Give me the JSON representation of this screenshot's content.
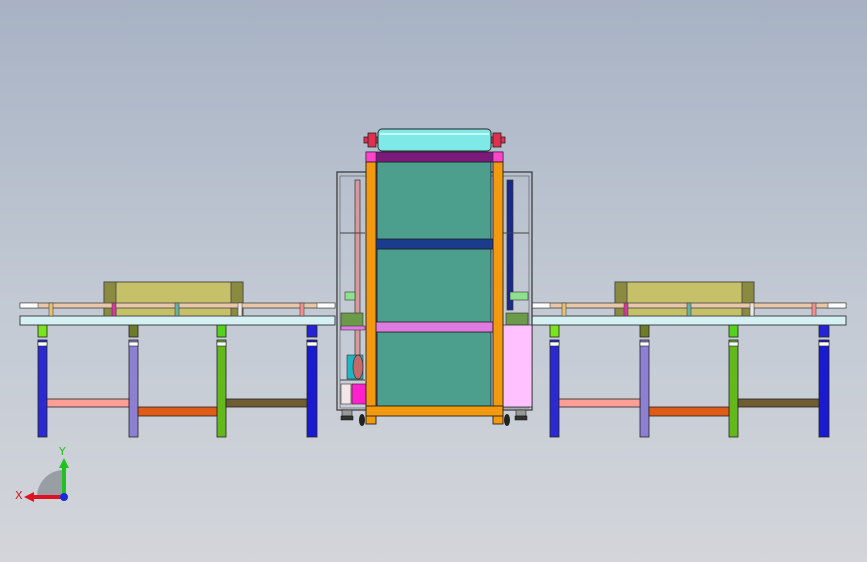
{
  "view": {
    "background_top": "#a7b2c4",
    "background_bottom": "#d3d5da"
  },
  "triad": {
    "x_label": "X",
    "y_label": "Y",
    "x_color": "#e0141e",
    "y_color": "#1fc21f",
    "z_color": "#1a2cd8"
  },
  "colors": {
    "frame_orange": "#f2990f",
    "panel_teal": "#4c9f8c",
    "roller_cyan": "#7fe9e8",
    "rail_pale": "#d6f1f4",
    "khaki_box": "#c6c069",
    "pink_box": "#ffc1ff",
    "purple_bar": "#7c1a7c",
    "navy_bar": "#1b3b8c",
    "leg_blue": "#2b2ad0",
    "leg_purple": "#8d7fd2",
    "leg_green": "#63b81b",
    "brace_salmon": "#ff9e96",
    "brace_red": "#e05a18",
    "brace_brown": "#6e5d33"
  }
}
